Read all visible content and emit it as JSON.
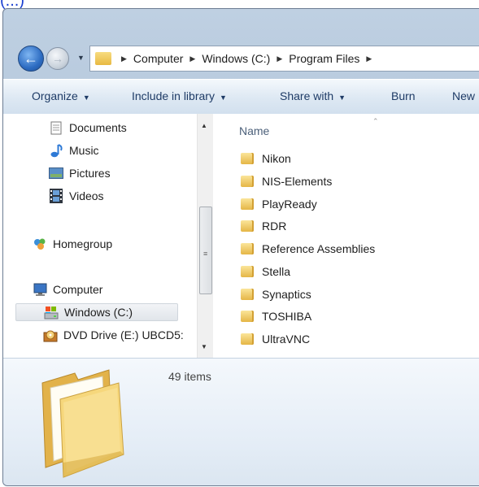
{
  "link_fragment": "(...)",
  "breadcrumb": [
    "Computer",
    "Windows (C:)",
    "Program Files"
  ],
  "commands": [
    {
      "label": "Organize",
      "caret": true
    },
    {
      "label": "Include in library",
      "caret": true
    },
    {
      "label": "Share with",
      "caret": true
    },
    {
      "label": "Burn",
      "caret": false
    },
    {
      "label": "New",
      "caret": false
    }
  ],
  "nav_items": [
    {
      "label": "Documents",
      "icon": "documents-icon"
    },
    {
      "label": "Music",
      "icon": "music-icon"
    },
    {
      "label": "Pictures",
      "icon": "pictures-icon"
    },
    {
      "label": "Videos",
      "icon": "videos-icon"
    },
    {
      "label": "Homegroup",
      "icon": "homegroup-icon"
    },
    {
      "label": "Computer",
      "icon": "computer-icon"
    },
    {
      "label": "Windows (C:)",
      "icon": "drive-icon",
      "selected": true
    },
    {
      "label": "DVD Drive (E:) UBCD5:",
      "icon": "dvd-drive-icon"
    }
  ],
  "column_header": "Name",
  "files": [
    "Nikon",
    "NIS-Elements",
    "PlayReady",
    "RDR",
    "Reference Assemblies",
    "Stella",
    "Synaptics",
    "TOSHIBA",
    "UltraVNC"
  ],
  "status": {
    "items_count": "49 items"
  },
  "colors": {
    "accent": "#1e3b66",
    "folder": "#e8b942",
    "selection": "#e1e5ea"
  }
}
